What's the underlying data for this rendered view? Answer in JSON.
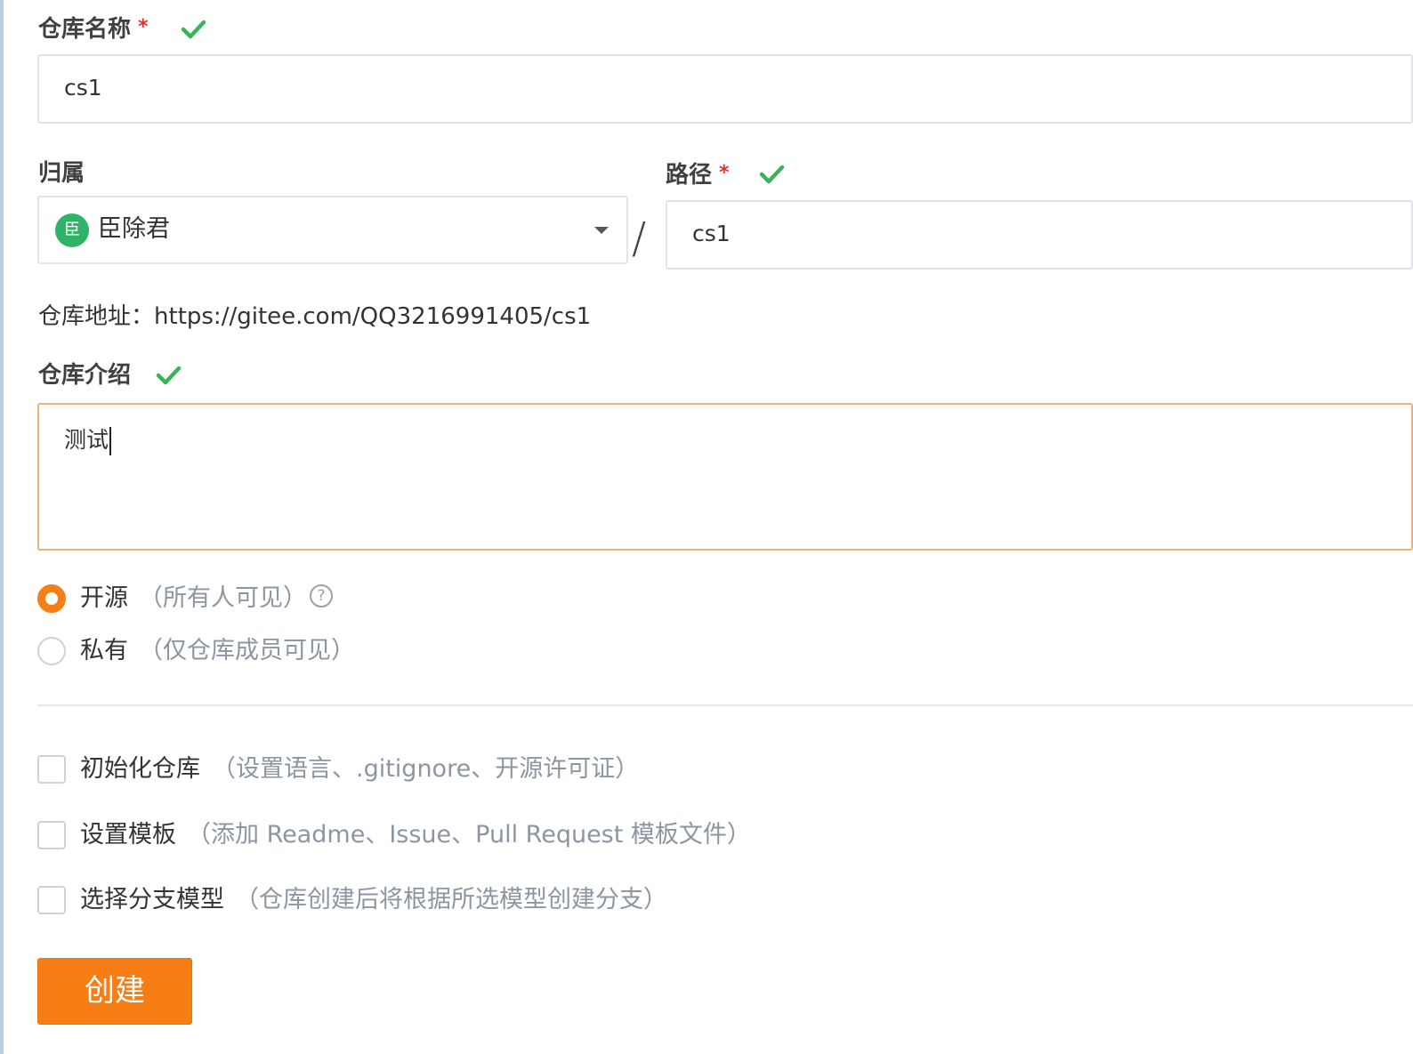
{
  "form": {
    "repo_name": {
      "label": "仓库名称",
      "required_mark": "*",
      "value": "cs1"
    },
    "owner": {
      "label": "归属",
      "avatar_text": "臣",
      "value": "臣除君"
    },
    "separator": "/",
    "path": {
      "label": "路径",
      "required_mark": "*",
      "value": "cs1"
    },
    "repo_url": {
      "prefix": "仓库地址：",
      "url": "https://gitee.com/QQ3216991405/cs1"
    },
    "description": {
      "label": "仓库介绍",
      "value": "测试"
    },
    "visibility": {
      "public_label": "开源",
      "public_hint": "（所有人可见）",
      "help_glyph": "?",
      "private_label": "私有",
      "private_hint": "（仅仓库成员可见）",
      "selected": "public"
    },
    "options": {
      "init_repo_label": "初始化仓库",
      "init_repo_hint": "（设置语言、.gitignore、开源许可证）",
      "template_label": "设置模板",
      "template_hint": "（添加 Readme、Issue、Pull Request 模板文件）",
      "branch_model_label": "选择分支模型",
      "branch_model_hint": "（仓库创建后将根据所选模型创建分支）"
    },
    "submit_label": "创建"
  },
  "colors": {
    "accent": "#f67e15",
    "valid_check": "#3bb35a",
    "required": "#e0322b",
    "hint_text": "#8c96a3",
    "avatar_bg": "#2fb369"
  },
  "icons": {
    "valid": "check-icon",
    "dropdown": "caret-down-icon",
    "help": "question-circle-icon"
  }
}
